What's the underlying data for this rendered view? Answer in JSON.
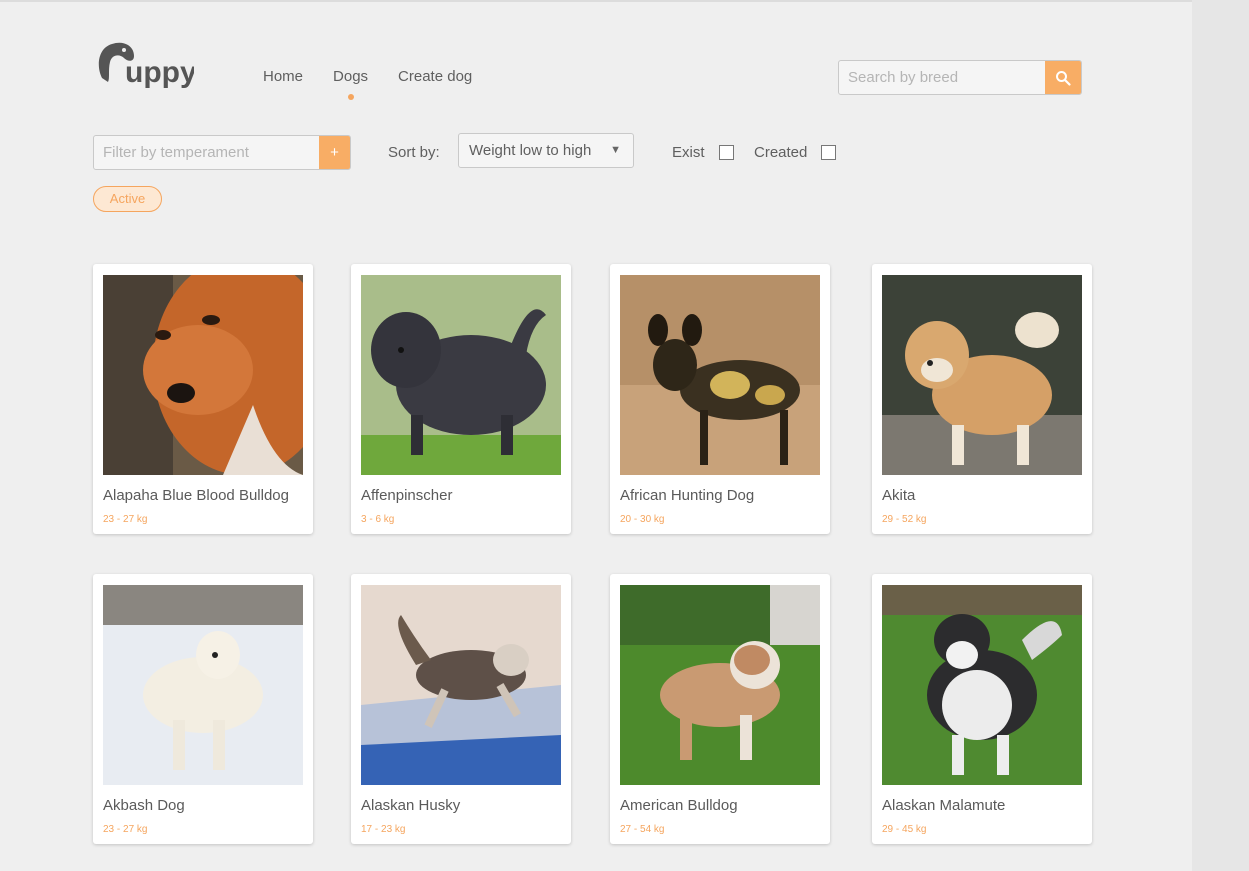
{
  "brand": {
    "logo_text": "uppy",
    "accent_color": "#f8ad65"
  },
  "nav": {
    "items": [
      {
        "label": "Home"
      },
      {
        "label": "Dogs",
        "active": true
      },
      {
        "label": "Create dog"
      }
    ]
  },
  "search": {
    "placeholder": "Search by breed",
    "icon": "search-icon"
  },
  "filters": {
    "temperament_placeholder": "Filter by temperament",
    "add_label": "+",
    "sort_label": "Sort by:",
    "sort_selected": "Weight low to high",
    "exist_label": "Exist",
    "created_label": "Created",
    "active_chip": "Active"
  },
  "dogs": [
    {
      "name": "Alapaha Blue Blood Bulldog",
      "weight": "23 - 27 kg"
    },
    {
      "name": "Affenpinscher",
      "weight": "3 - 6 kg"
    },
    {
      "name": "African Hunting Dog",
      "weight": "20 - 30 kg"
    },
    {
      "name": "Akita",
      "weight": "29 - 52 kg"
    },
    {
      "name": "Akbash Dog",
      "weight": "23 - 27 kg"
    },
    {
      "name": "Alaskan Husky",
      "weight": "17 - 23 kg"
    },
    {
      "name": "American Bulldog",
      "weight": "27 - 54 kg"
    },
    {
      "name": "Alaskan Malamute",
      "weight": "29 - 45 kg"
    }
  ]
}
